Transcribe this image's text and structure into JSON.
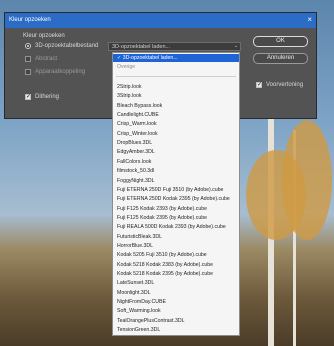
{
  "dialog": {
    "title": "Kleur opzoeken",
    "close_label": "×",
    "group_label": "Kleur opzoeken",
    "options": [
      {
        "label": "3D-opzoektabelbestand",
        "selected": true
      },
      {
        "label": "Abstract",
        "selected": false
      },
      {
        "label": "Apparaatkoppeling",
        "selected": false
      }
    ],
    "dithering_label": "Dithering",
    "preview_label": "Voorvertoning",
    "select_value": "3D-opzoektabel laden...",
    "ok_label": "OK",
    "cancel_label": "Annuleren"
  },
  "dropdown": {
    "selected": "3D-opzoektabel laden...",
    "secondary": "Overige",
    "items": [
      "2Strip.look",
      "3Strip.look",
      "Bleach Bypass.look",
      "Candlelight.CUBE",
      "Crisp_Warm.look",
      "Crisp_Winter.look",
      "DropBlues.3DL",
      "EdgyAmber.3DL",
      "FallColors.look",
      "filmstock_50.3dl",
      "FoggyNight.3DL",
      "Fuji ETERNA 250D Fuji 3510 (by Adobe).cube",
      "Fuji ETERNA 250D Kodak 2395 (by Adobe).cube",
      "Fuji F125 Kodak 2393 (by Adobe).cube",
      "Fuji F125 Kodak 2395 (by Adobe).cube",
      "Fuji REALA 500D Kodak 2393 (by Adobe).cube",
      "FuturisticBleak.3DL",
      "HorrorBlue.3DL",
      "Kodak 5205 Fuji 3510 (by Adobe).cube",
      "Kodak 5218 Kodak 2383 (by Adobe).cube",
      "Kodak 5218 Kodak 2395 (by Adobe).cube",
      "LateSunset.3DL",
      "Moonlight.3DL",
      "NightFromDay.CUBE",
      "Soft_Warming.look",
      "TealOrangePlusContrast.3DL",
      "TensionGreen.3DL"
    ]
  },
  "colors": {
    "titlebar": "#2b6cc7",
    "panel": "#535353",
    "selection": "#1e64d6"
  }
}
